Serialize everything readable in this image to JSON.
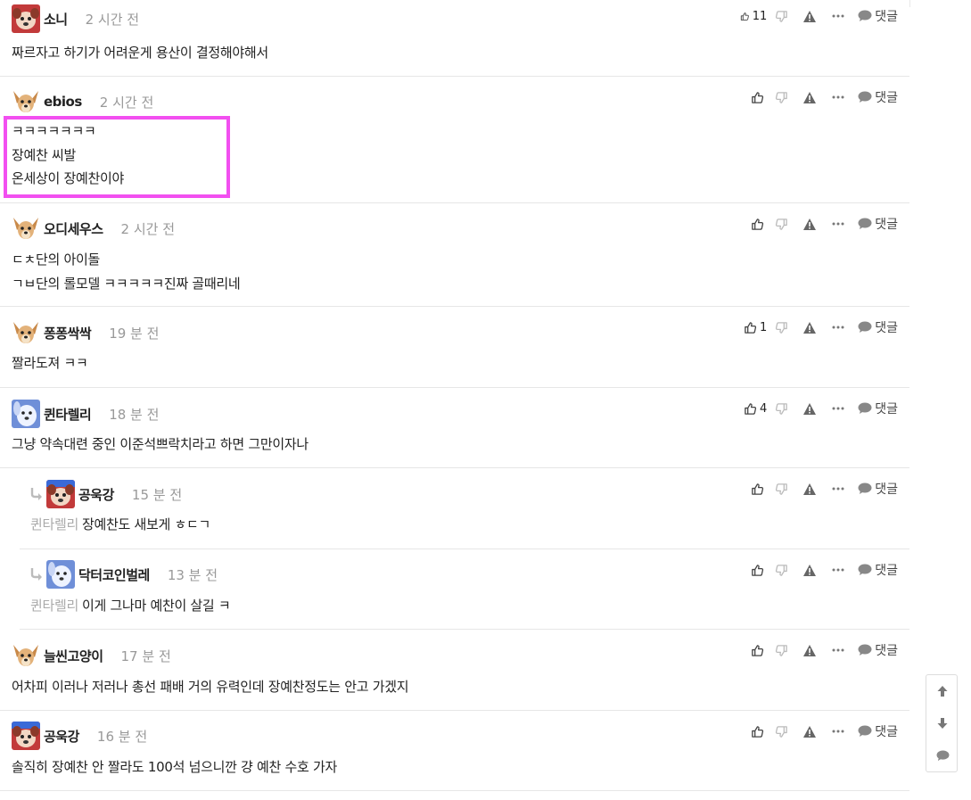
{
  "comments": [
    {
      "nick": "소니",
      "time": "2 시간 전",
      "likes": "11",
      "reply_label": "댓글",
      "lines": [
        "짜르자고 하기가 어려운게 용산이 결정해야해서"
      ],
      "avatar": "red-pink-dog"
    },
    {
      "nick": "ebios",
      "time": "2 시간 전",
      "likes": "",
      "reply_label": "댓글",
      "lines": [
        "ㅋㅋㅋㅋㅋㅋㅋ",
        "장예찬 씨발",
        "온세상이 장예찬이야"
      ],
      "avatar": "chihuahua"
    },
    {
      "nick": "오디세우스",
      "time": "2 시간 전",
      "likes": "",
      "reply_label": "댓글",
      "lines": [
        "ㄷㅊ단의 아이돌",
        "ㄱㅂ단의 롤모델 ㅋㅋㅋㅋㅋ진짜 골때리네"
      ],
      "avatar": "chihuahua"
    },
    {
      "nick": "퐁퐁싹싹",
      "time": "19 분 전",
      "likes": "1",
      "reply_label": "댓글",
      "lines": [
        "짤라도져 ㅋㅋ"
      ],
      "avatar": "chihuahua"
    },
    {
      "nick": "퀸타렐리",
      "time": "18 분 전",
      "likes": "4",
      "reply_label": "댓글",
      "lines": [
        "그냥 약속대련 중인 이준석쁘락치라고 하면 그만이자나"
      ],
      "avatar": "blue-dog"
    },
    {
      "nick": "공욱강",
      "time": "15 분 전",
      "likes": "",
      "reply_label": "댓글",
      "mention": "퀸타렐리",
      "lines": [
        "장예찬도 새보게 ㅎㄷㄱ"
      ],
      "avatar": "red-blue-dog"
    },
    {
      "nick": "닥터코인벌레",
      "time": "13 분 전",
      "likes": "",
      "reply_label": "댓글",
      "mention": "퀸타렐리",
      "lines": [
        "이게 그나마 예찬이 살길 ㅋ"
      ],
      "avatar": "blue-dog"
    },
    {
      "nick": "늘씬고양이",
      "time": "17 분 전",
      "likes": "",
      "reply_label": "댓글",
      "lines": [
        "어차피 이러나 저러나 총선 패배 거의 유력인데 장예찬정도는 안고 가겠지"
      ],
      "avatar": "chihuahua"
    },
    {
      "nick": "공욱강",
      "time": "16 분 전",
      "likes": "",
      "reply_label": "댓글",
      "lines": [
        "솔직히 장예찬 안 짤라도 100석 넘으니깐 걍 예찬 수호 가자"
      ],
      "avatar": "red-blue-dog"
    }
  ],
  "icons": {
    "like": "thumbs-up-icon",
    "dislike": "thumbs-down-icon",
    "report": "warning-icon",
    "more": "more-dots-icon",
    "reply": "speech-bubble-icon",
    "reply_indicator": "reply-arrow-icon",
    "scroll_up": "arrow-up-icon",
    "scroll_down": "arrow-down-icon",
    "scroll_comment": "comment-icon"
  },
  "colors": {
    "highlight": "#f24ff0",
    "icon": "#555555",
    "muted": "#999999",
    "divider": "#e6e6e6"
  }
}
